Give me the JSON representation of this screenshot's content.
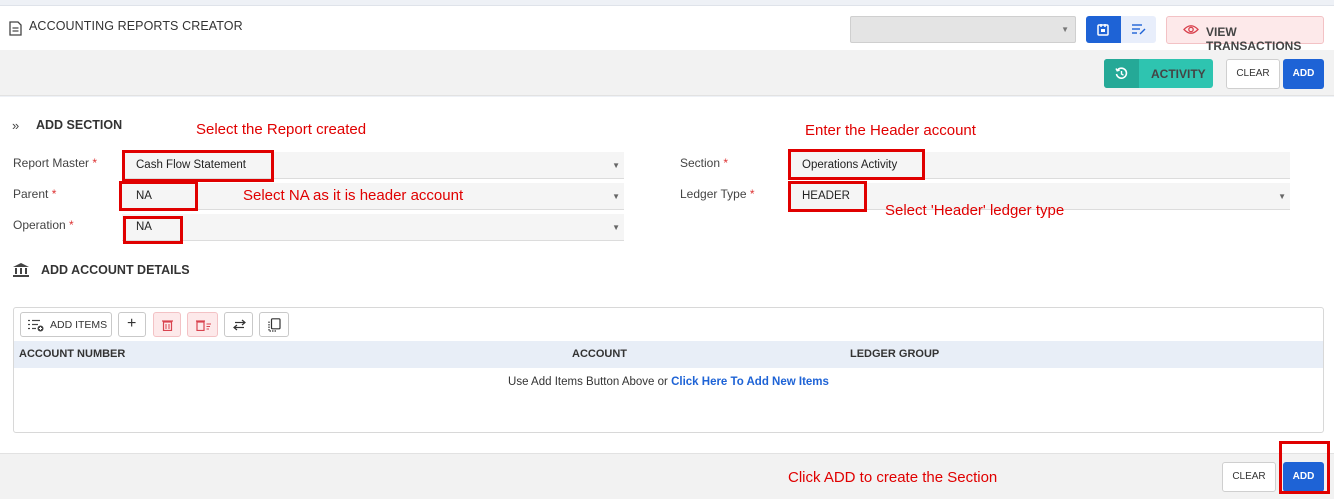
{
  "header": {
    "title": "ACCOUNTING REPORTS CREATOR",
    "report_select_value": "",
    "view_transactions_label": "VIEW TRANSACTIONS"
  },
  "toolbar": {
    "activity_label": "ACTIVITY",
    "clear_label": "CLEAR",
    "add_label": "ADD"
  },
  "add_section": {
    "title": "ADD SECTION",
    "fields": {
      "report_master": {
        "label": "Report Master",
        "required": "*",
        "value": "Cash Flow Statement"
      },
      "parent": {
        "label": "Parent",
        "required": "*",
        "value": "NA"
      },
      "operation": {
        "label": "Operation",
        "required": "*",
        "value": "NA"
      },
      "section": {
        "label": "Section",
        "required": "*",
        "value": "Operations Activity"
      },
      "ledger_type": {
        "label": "Ledger Type",
        "required": "*",
        "value": "HEADER"
      }
    }
  },
  "account_details": {
    "title": "ADD ACCOUNT DETAILS",
    "add_items_label": "ADD ITEMS",
    "columns": [
      "ACCOUNT NUMBER",
      "ACCOUNT",
      "LEDGER GROUP"
    ],
    "empty_text": "Use Add Items Button Above or",
    "empty_link": "Click Here To Add New Items"
  },
  "footer": {
    "clear_label": "CLEAR",
    "add_label": "ADD"
  },
  "annotations": {
    "report": "Select the Report created",
    "header_account": "Enter the Header account",
    "parent_na": "Select NA as it is header account",
    "ledger_header": "Select 'Header' ledger type",
    "click_add": "Click ADD to create the Section"
  },
  "colors": {
    "primary": "#1e63d6",
    "activity": "#2ec4b0",
    "annotation": "#e00000",
    "danger": "#d9434f"
  }
}
